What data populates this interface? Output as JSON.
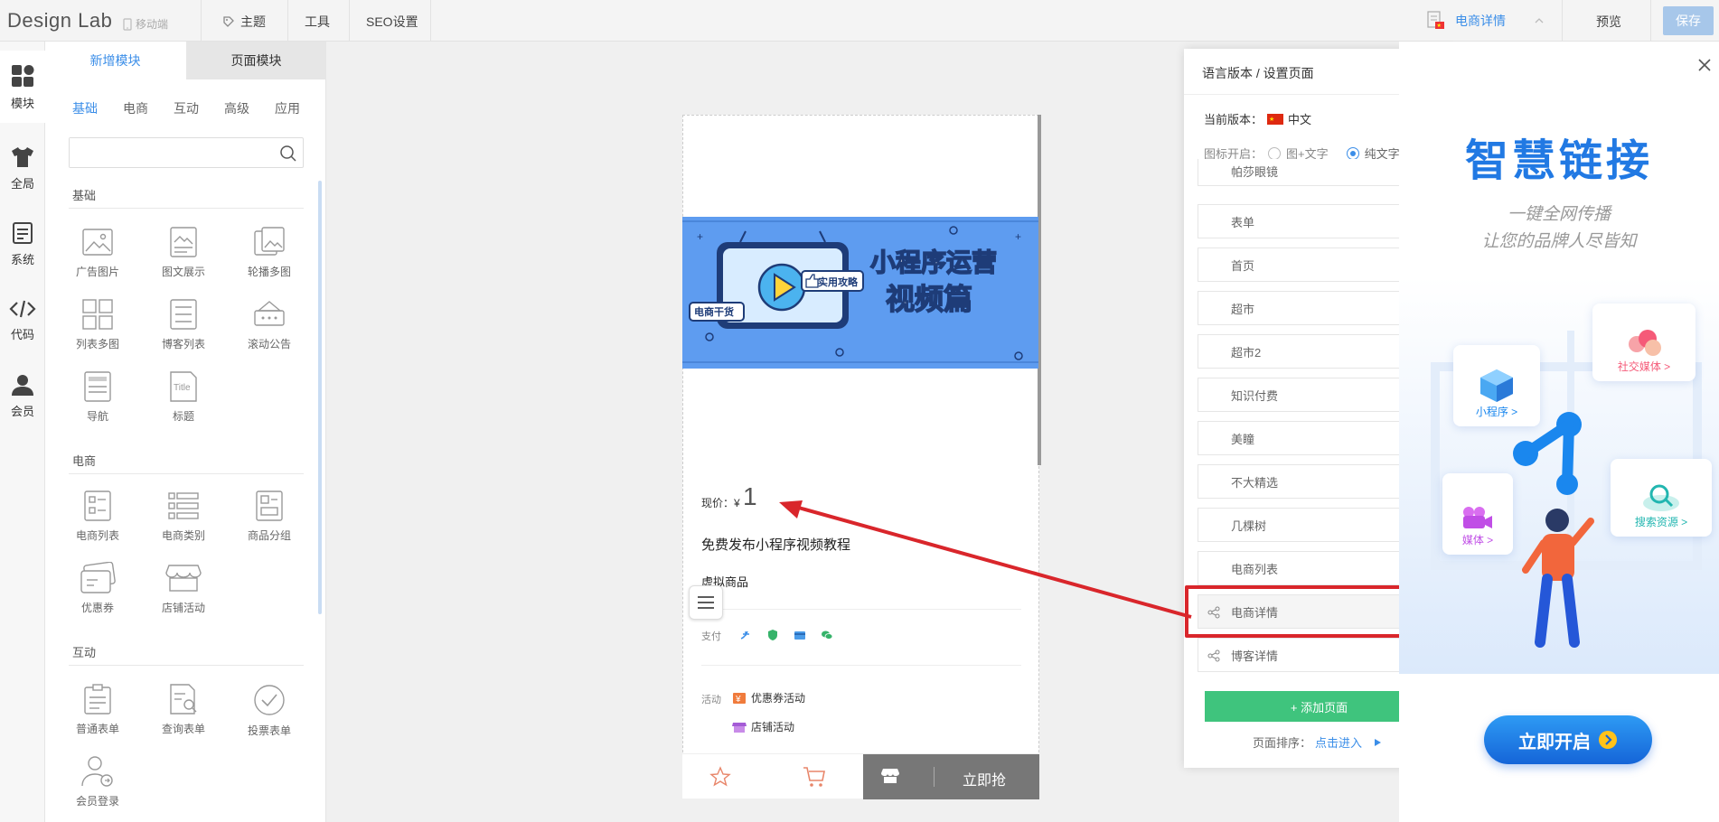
{
  "topbar": {
    "logo": "Design Lab",
    "mobile_end": "移动端",
    "nav": [
      "主题",
      "工具",
      "SEO设置"
    ],
    "current_page": "电商详情",
    "preview": "预览",
    "save": "保存"
  },
  "iconbar": {
    "items": [
      {
        "label": "模块",
        "icon": "modules-icon"
      },
      {
        "label": "全局",
        "icon": "tshirt-icon"
      },
      {
        "label": "系统",
        "icon": "document-icon"
      },
      {
        "label": "代码",
        "icon": "code-icon"
      },
      {
        "label": "会员",
        "icon": "user-icon"
      }
    ]
  },
  "panel": {
    "tabs": [
      "新增模块",
      "页面模块"
    ],
    "subtabs": [
      "基础",
      "电商",
      "互动",
      "高级",
      "应用"
    ],
    "search_placeholder": "",
    "sections": [
      {
        "title": "基础",
        "modules": [
          "广告图片",
          "图文展示",
          "轮播多图",
          "列表多图",
          "博客列表",
          "滚动公告",
          "导航",
          "标题"
        ]
      },
      {
        "title": "电商",
        "modules": [
          "电商列表",
          "电商类别",
          "商品分组",
          "优惠券",
          "店铺活动"
        ]
      },
      {
        "title": "互动",
        "modules": [
          "普通表单",
          "查询表单",
          "投票表单",
          "会员登录"
        ]
      }
    ]
  },
  "phone": {
    "banner": {
      "title1": "小程序运营",
      "title2": "视频篇",
      "tag": "电商干货",
      "badge": "实用攻略"
    },
    "price_label": "现价：",
    "currency": "¥",
    "price": "1",
    "product_title": "免费发布小程序视频教程",
    "product_type": "虚拟商品",
    "pay_label": "支付",
    "activity_label": "活动",
    "activities": [
      "优惠券活动",
      "店铺活动"
    ],
    "buy_now": "立即抢"
  },
  "lang_panel": {
    "title": "语言版本 / 设置页面",
    "current_version_label": "当前版本：",
    "current_version": "中文",
    "icon_label": "图标开启：",
    "icon_options": [
      "图+文字",
      "纯文字"
    ],
    "icon_selected": "纯文字",
    "pages": [
      "帕莎眼镜",
      "表单",
      "首页",
      "超市",
      "超市2",
      "知识付费",
      "美瞳",
      "不大精选",
      "几棵树",
      "电商列表",
      "电商详情",
      "博客详情"
    ],
    "selected_page": "电商详情",
    "add_page": "+ 添加页面",
    "sort_label": "页面排序：",
    "sort_link": "点击进入"
  },
  "ad": {
    "title": "智慧链接",
    "sub1": "一键全网传播",
    "sub2": "让您的品牌人尽皆知",
    "cards": [
      "社交媒体 >",
      "小程序 >",
      "媒体 >",
      "搜索资源 >"
    ],
    "button": "立即开启"
  },
  "colors": {
    "accent": "#3b8ee8",
    "green": "#3fc47d",
    "highlight": "#d9262b",
    "banner": "#5e9cf0"
  }
}
